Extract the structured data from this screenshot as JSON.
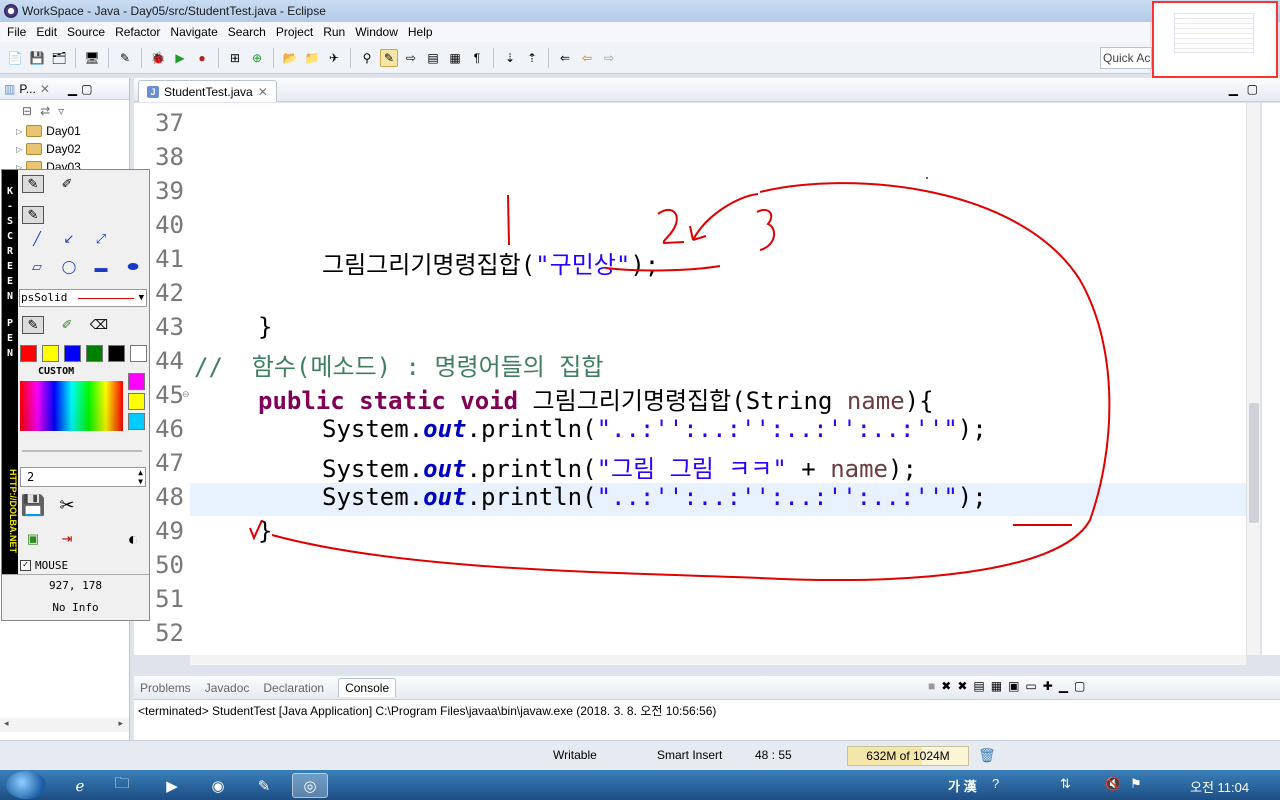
{
  "window": {
    "title": "WorkSpace - Java - Day05/src/StudentTest.java - Eclipse"
  },
  "menu": [
    "File",
    "Edit",
    "Source",
    "Refactor",
    "Navigate",
    "Search",
    "Project",
    "Run",
    "Window",
    "Help"
  ],
  "quick_access": "Quick Ac",
  "package_explorer": {
    "tab_label": "P...",
    "items": [
      "Day01",
      "Day02",
      "Day03"
    ]
  },
  "editor": {
    "tab_label": "StudentTest.java",
    "line_numbers": [
      "37",
      "38",
      "39",
      "40",
      "41",
      "42",
      "43",
      "44",
      "45",
      "46",
      "47",
      "48",
      "49",
      "50",
      "51",
      "52"
    ],
    "code": {
      "l41_call": "그림그리기명령집합(",
      "l41_arg": "\"구민상\"",
      "l41_end": ");",
      "l43": "}",
      "l44": "//  함수(메소드) : 명령어들의 집합",
      "l45_kw": "public static void",
      "l45_name": " 그림그리기명령집합(String ",
      "l45_param": "name",
      "l45_end": "){",
      "sys": "System.",
      "out": "out",
      "println": ".println(",
      "l46_str": "\"..:'':..:'':..:'':..:''\"",
      "l47_str": "\"그림 그림 ㅋㅋ\"",
      "l47_rest": " + ",
      "l47_param": "name",
      "l48_str": "\"..:'':..:'':..:'':..:''\"",
      "end": ");",
      "l49": "}"
    }
  },
  "console": {
    "tabs": [
      "Problems",
      "Javadoc",
      "Declaration",
      "Console"
    ],
    "active_tab": "Console",
    "output": "<terminated> StudentTest [Java Application] C:\\Program Files\\javaa\\bin\\javaw.exe (2018. 3. 8. 오전 10:56:56)"
  },
  "status": {
    "writable": "Writable",
    "insert_mode": "Smart Insert",
    "position": "48 : 55",
    "heap": "632M of 1024M",
    "heap_fraction": 0.62
  },
  "kpen": {
    "brand_letters": [
      "K",
      "-",
      "S",
      "C",
      "R",
      "E",
      "E",
      "N",
      "",
      "P",
      "E",
      "N"
    ],
    "url": "HTTP://DOLBA.NET",
    "line_style": "psSolid",
    "custom_label": "CUSTOM",
    "size": "2",
    "mouse_label": "MOUSE",
    "coords": "927, 178",
    "info": "No Info",
    "colors": [
      "#ff0000",
      "#ffff00",
      "#0000ff",
      "#008000",
      "#000000",
      "#ffffff"
    ],
    "custom_colors": [
      "#ff00ff",
      "#ffff00",
      "#00ccff"
    ]
  },
  "taskbar": {
    "ime": "가 漢",
    "clock": "오전 11:04"
  },
  "colors": {
    "keyword": "#7f0055",
    "string": "#2a00ff",
    "comment": "#3f7f5f",
    "annotation": "#e00000"
  }
}
